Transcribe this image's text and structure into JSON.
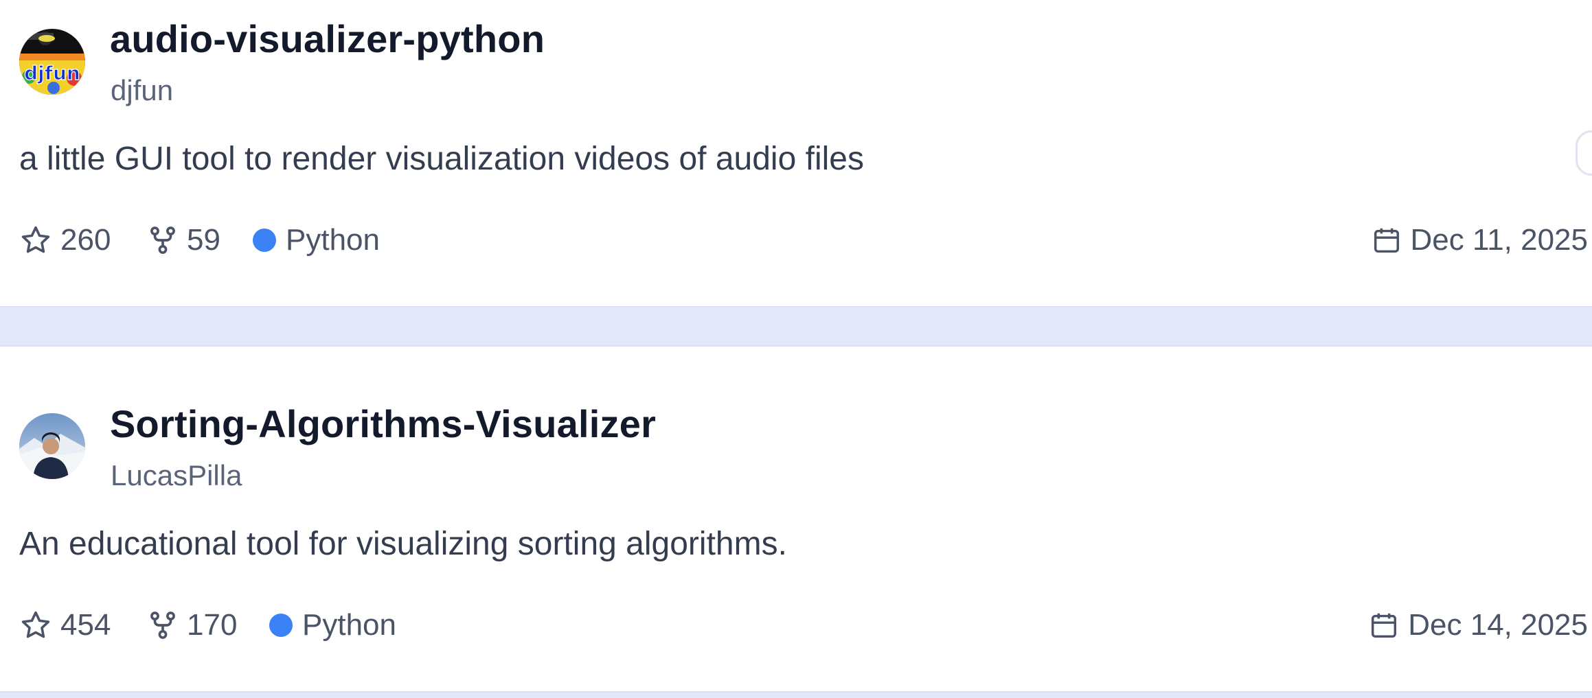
{
  "repos": [
    {
      "name": "audio-visualizer-python",
      "owner": "djfun",
      "description": "a little GUI tool to render visualization videos of audio files",
      "stars": "260",
      "forks": "59",
      "language": "Python",
      "language_color": "#3b82f6",
      "date": "Dec 11, 2025",
      "avatar_icon": "djfun-logo-avatar",
      "avatar_text": "djfun"
    },
    {
      "name": "Sorting-Algorithms-Visualizer",
      "owner": "LucasPilla",
      "description": "An educational tool for visualizing sorting algorithms.",
      "stars": "454",
      "forks": "170",
      "language": "Python",
      "language_color": "#3b82f6",
      "date": "Dec 14, 2025",
      "avatar_icon": "person-photo-avatar"
    }
  ],
  "icons": {
    "star": "star-icon",
    "fork": "fork-icon",
    "calendar": "calendar-icon"
  }
}
